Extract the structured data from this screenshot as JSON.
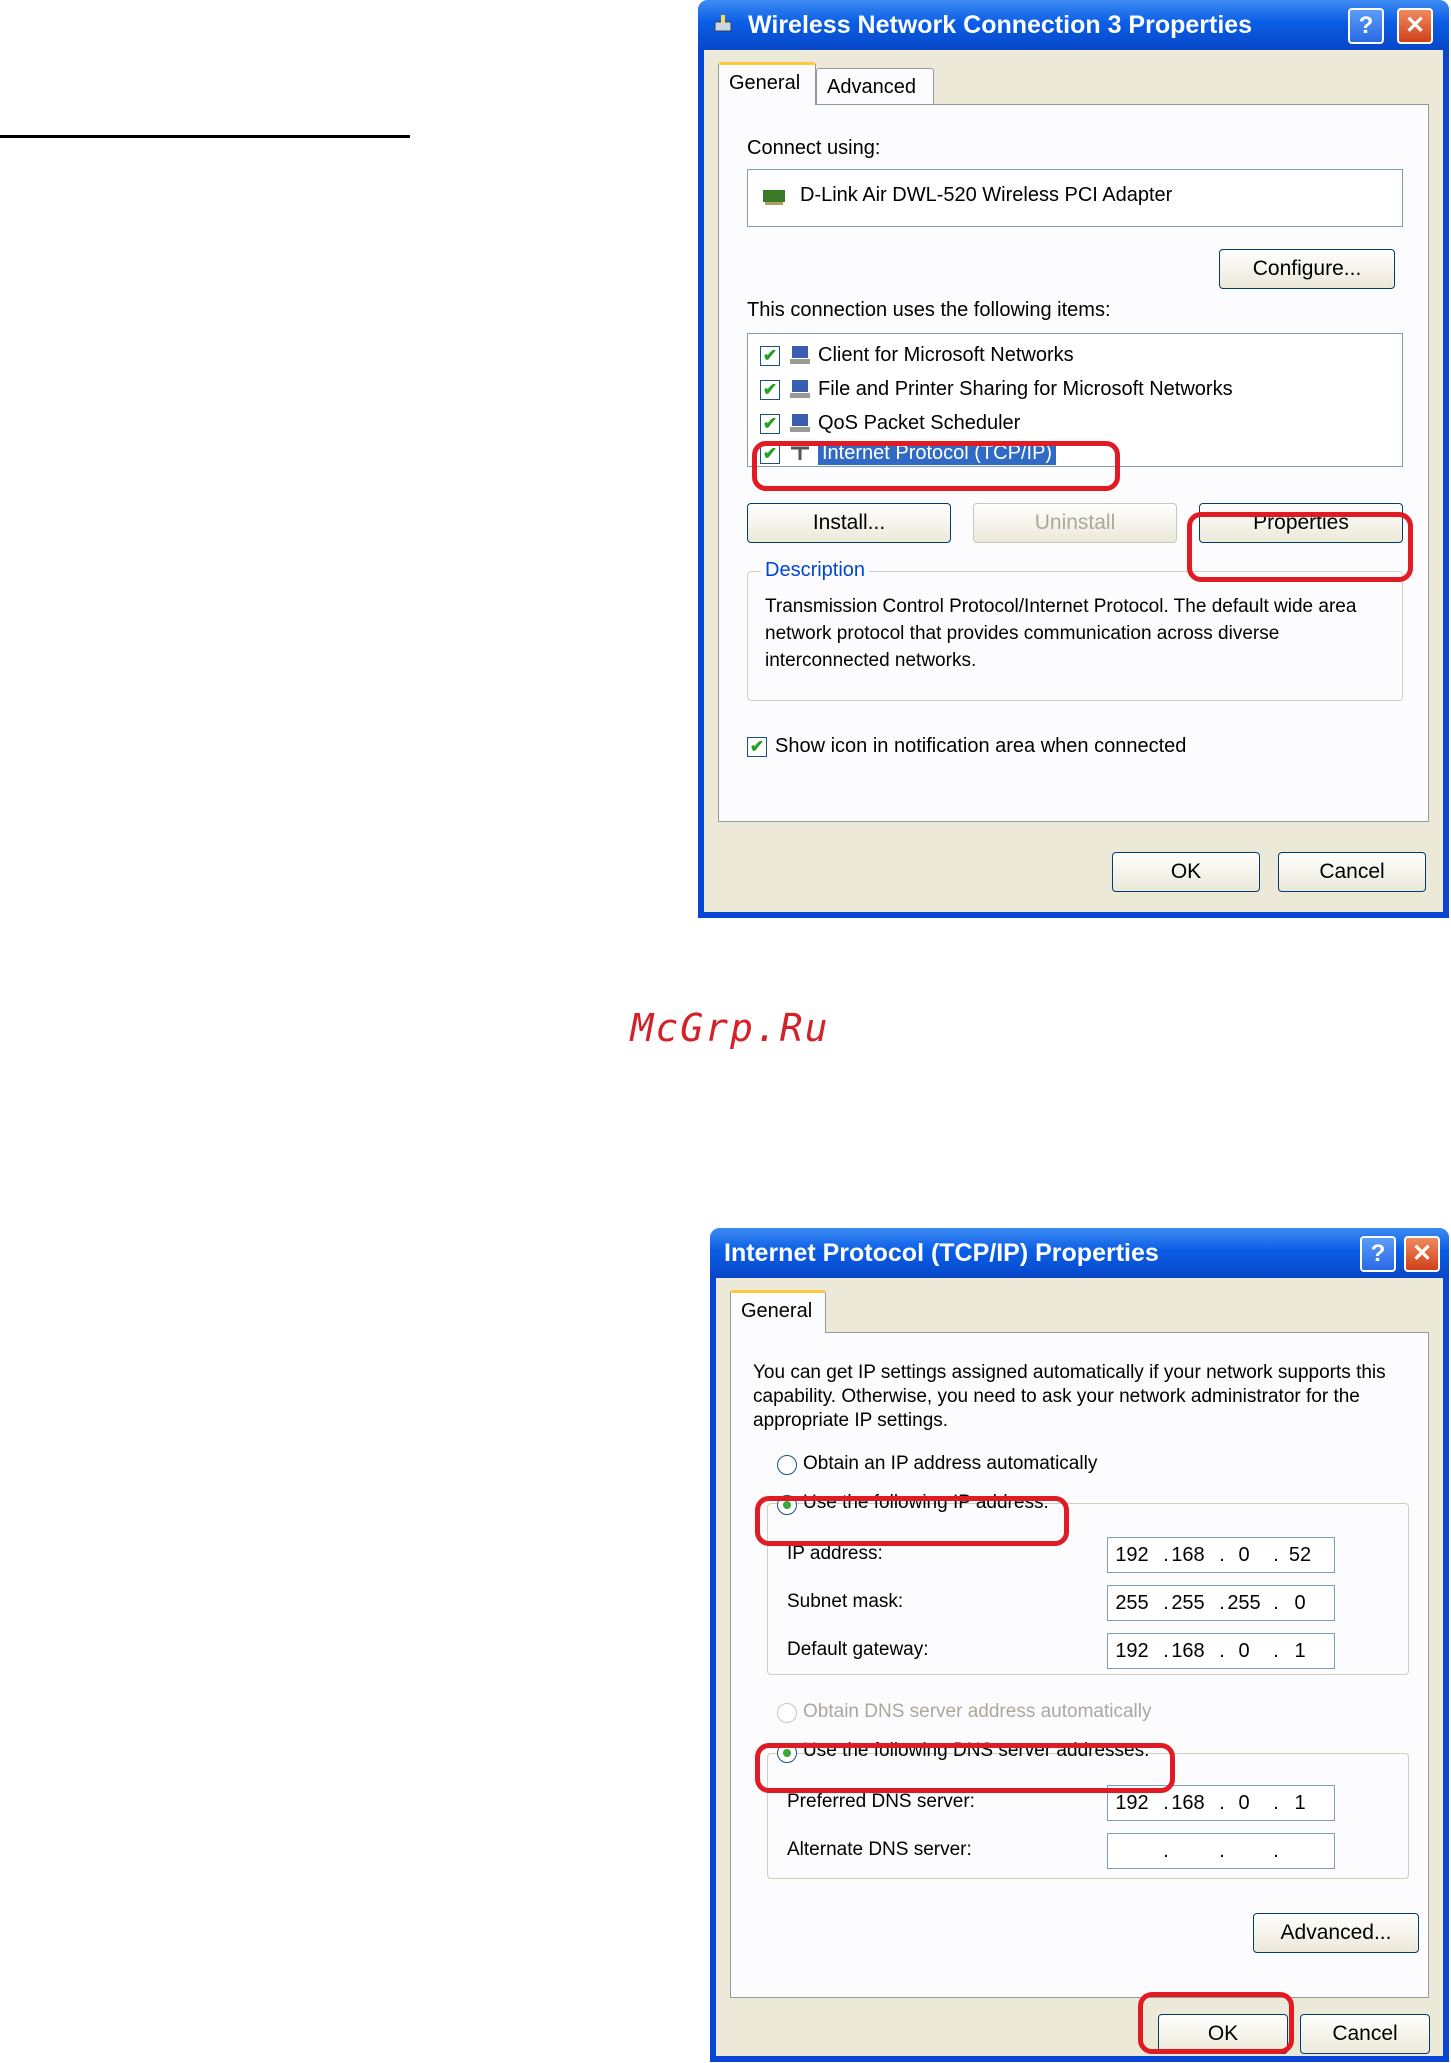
{
  "watermark": "McGrp.Ru",
  "dialog1": {
    "title": "Wireless Network Connection 3 Properties",
    "tabs": [
      "General",
      "Advanced"
    ],
    "connect_using_label": "Connect using:",
    "adapter": "D-Link Air DWL-520 Wireless PCI Adapter",
    "configure_label": "Configure...",
    "items_label": "This connection uses the following items:",
    "items": [
      {
        "label": "Client for Microsoft Networks",
        "checked": true
      },
      {
        "label": "File and Printer Sharing for Microsoft Networks",
        "checked": true
      },
      {
        "label": "QoS Packet Scheduler",
        "checked": true
      },
      {
        "label": "Internet Protocol (TCP/IP)",
        "checked": true,
        "selected": true
      }
    ],
    "install_label": "Install...",
    "uninstall_label": "Uninstall",
    "properties_label": "Properties",
    "description_label": "Description",
    "description_text": "Transmission Control Protocol/Internet Protocol. The default wide area network protocol that provides communication across diverse interconnected networks.",
    "show_icon_label": "Show icon in notification area when connected",
    "ok_label": "OK",
    "cancel_label": "Cancel"
  },
  "dialog2": {
    "title": "Internet Protocol (TCP/IP) Properties",
    "tabs": [
      "General"
    ],
    "intro": "You can get IP settings assigned automatically if your network supports this capability. Otherwise, you need to ask your network administrator for the appropriate IP settings.",
    "obtain_ip_label": "Obtain an IP address automatically",
    "use_ip_label": "Use the following IP address:",
    "ip_fields": [
      {
        "label": "IP address:",
        "octets": [
          "192",
          "168",
          "0",
          "52"
        ]
      },
      {
        "label": "Subnet mask:",
        "octets": [
          "255",
          "255",
          "255",
          "0"
        ]
      },
      {
        "label": "Default gateway:",
        "octets": [
          "192",
          "168",
          "0",
          "1"
        ]
      }
    ],
    "obtain_dns_label": "Obtain DNS server address automatically",
    "use_dns_label": "Use the following DNS server addresses:",
    "dns_fields": [
      {
        "label": "Preferred DNS server:",
        "octets": [
          "192",
          "168",
          "0",
          "1"
        ]
      },
      {
        "label": "Alternate DNS server:",
        "octets": [
          "",
          "",
          "",
          ""
        ]
      }
    ],
    "advanced_label": "Advanced...",
    "ok_label": "OK",
    "cancel_label": "Cancel"
  },
  "colors": {
    "highlight": "#e01b24",
    "titlebar": "#0a5ee6",
    "dialog_face": "#ece9d8",
    "selection": "#316ac5"
  }
}
